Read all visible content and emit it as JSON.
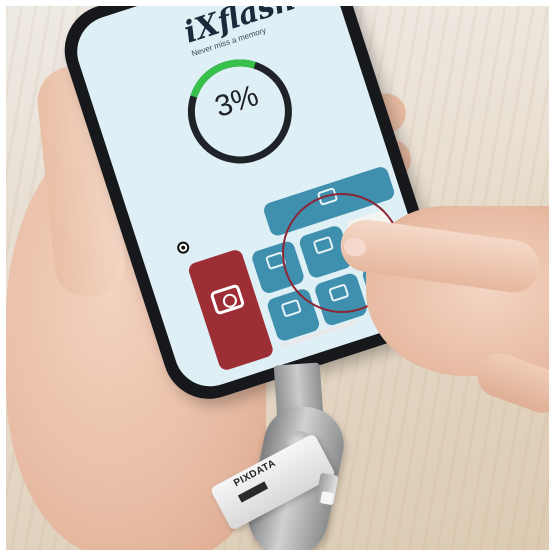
{
  "app": {
    "brand": "iXflash",
    "tagline": "Never miss a memory",
    "progress_percent_label": "3%",
    "progress_fraction": 0.03,
    "storage_sub": "",
    "tiles": [
      {
        "name": "backup-tile",
        "label": ""
      },
      {
        "name": "camera-tile",
        "label": ""
      },
      {
        "name": "photos-tile",
        "label": ""
      },
      {
        "name": "music-tile",
        "label": ""
      },
      {
        "name": "contacts-tile",
        "label": ""
      },
      {
        "name": "files-tile",
        "label": ""
      },
      {
        "name": "favorites-tile",
        "label": ""
      },
      {
        "name": "settings-tile",
        "label": ""
      }
    ]
  },
  "device": {
    "drive_logo": "PIXDATA",
    "drive_badge": ""
  },
  "colors": {
    "screen_bg": "#dfeff6",
    "tile_blue": "#3f8fae",
    "tile_red": "#9e2e36",
    "highlight_ring": "#8c2633",
    "progress_green": "#37c04a"
  },
  "icons": [
    "camera-icon",
    "photo-icon",
    "music-icon",
    "phone-icon",
    "heart-icon",
    "document-icon"
  ]
}
